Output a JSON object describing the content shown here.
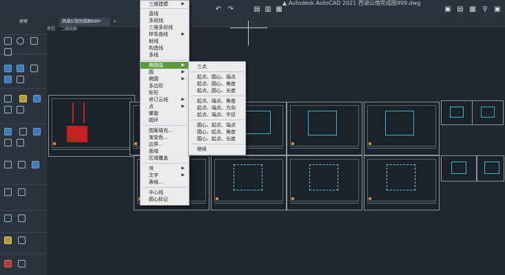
{
  "title": {
    "app": "Autodesk AutoCAD 2021",
    "file": "西湖公馆完成图999.dwg"
  },
  "tabs": [
    {
      "label": "建模"
    },
    {
      "label": "西湖公馆完成图999*"
    }
  ],
  "viewbar": {
    "view": "俯视",
    "style": "二维线框"
  },
  "draw_menu": {
    "top_item": "三维建模",
    "items": [
      "直线",
      "多段线",
      "三维多段线",
      "样条曲线",
      "射线",
      "构造线",
      "多线",
      "椭圆弧",
      "圆",
      "椭圆",
      "多边形",
      "矩形",
      "修订云线",
      "点",
      "螺旋",
      "圆环",
      "图案填充...",
      "渐变色...",
      "边界...",
      "面域",
      "区域覆盖",
      "块",
      "文字",
      "表格...",
      "中心线",
      "圆心标记"
    ]
  },
  "arc_submenu": {
    "items": [
      "三点",
      "起点、圆心、端点",
      "起点、圆心、角度",
      "起点、圆心、长度",
      "起点、端点、角度",
      "起点、端点、方向",
      "起点、端点、半径",
      "圆心、起点、端点",
      "圆心、起点、角度",
      "圆心、起点、长度",
      "继续"
    ]
  },
  "colors": {
    "menu_highlight": "#5d9c3d",
    "drawing_cyan": "#43b5c9",
    "drawing_red": "#c81f1f"
  }
}
